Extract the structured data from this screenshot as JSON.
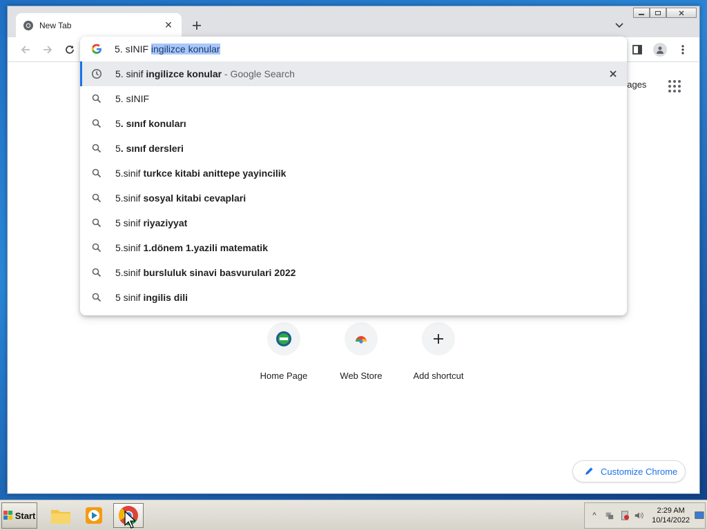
{
  "browser": {
    "tab": {
      "title": "New Tab"
    },
    "omnibox": {
      "typed_text": "5. sINIF ",
      "autocompleted_selected_text": "ingilizce konular"
    },
    "suggestions": [
      {
        "icon": "history-clock-icon",
        "normal": "5. sinif ",
        "bold": "ingilizce konular",
        "suffix": " - Google Search",
        "active": true
      },
      {
        "icon": "search-icon",
        "normal": "5. sINIF",
        "bold": "",
        "suffix": "",
        "active": false
      },
      {
        "icon": "search-icon",
        "normal": "5",
        "bold": ". sınıf konuları",
        "suffix": "",
        "active": false
      },
      {
        "icon": "search-icon",
        "normal": "5",
        "bold": ". sınıf dersleri",
        "suffix": "",
        "active": false
      },
      {
        "icon": "search-icon",
        "normal": "5.sinif ",
        "bold": "turkce kitabi anittepe yayincilik",
        "suffix": "",
        "active": false
      },
      {
        "icon": "search-icon",
        "normal": "5.sinif ",
        "bold": "sosyal kitabi cevaplari",
        "suffix": "",
        "active": false
      },
      {
        "icon": "search-icon",
        "normal": "5 sinif ",
        "bold": "riyaziyyat",
        "suffix": "",
        "active": false
      },
      {
        "icon": "search-icon",
        "normal": "5.sinif ",
        "bold": "1.dönem 1.yazili matematik",
        "suffix": "",
        "active": false
      },
      {
        "icon": "search-icon",
        "normal": "5.sinif ",
        "bold": "bursluluk sinavi basvurulari 2022",
        "suffix": "",
        "active": false
      },
      {
        "icon": "search-icon",
        "normal": "5 sinif ",
        "bold": "ingilis dili",
        "suffix": "",
        "active": false
      }
    ]
  },
  "ntp": {
    "images_link": "nages",
    "shortcuts": [
      {
        "label": "Home Page",
        "icon": "pbs-kids-icon"
      },
      {
        "label": "Web Store",
        "icon": "chrome-web-store-icon"
      },
      {
        "label": "Add shortcut",
        "icon": "plus-icon"
      }
    ],
    "customize_label": "Customize Chrome"
  },
  "taskbar": {
    "start_label": "Start",
    "clock_time": "2:29 AM",
    "clock_date": "10/14/2022"
  },
  "colors": {
    "accent": "#1a73e8",
    "selection": "#a8c7fa"
  }
}
